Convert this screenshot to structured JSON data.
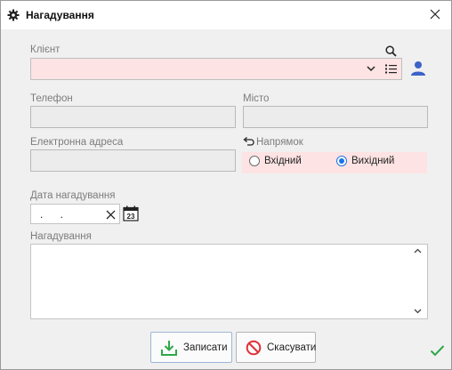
{
  "window": {
    "title": "Нагадування",
    "icon": "gear-icon",
    "close_icon": "close-icon"
  },
  "client": {
    "label": "Клієнт",
    "value": "",
    "search_icon": "search-icon",
    "dropdown_icon": "chevron-down-icon",
    "list_icon": "list-icon",
    "person_icon": "person-icon"
  },
  "phone": {
    "label": "Телефон",
    "value": ""
  },
  "city": {
    "label": "Місто",
    "value": ""
  },
  "email": {
    "label": "Електронна адреса",
    "value": ""
  },
  "direction": {
    "label": "Напрямок",
    "icon": "undo-arrow-icon",
    "options": [
      {
        "label": "Вхідний",
        "checked": false
      },
      {
        "label": "Вихідний",
        "checked": true
      }
    ]
  },
  "reminder_date": {
    "label": "Дата нагадування",
    "value": ". .",
    "calendar_day": "23"
  },
  "reminder_text": {
    "label": "Нагадування",
    "value": ""
  },
  "buttons": {
    "save_label": "Записати",
    "cancel_label": "Скасувати"
  },
  "colors": {
    "required_bg": "#fde3e3",
    "accent": "#1a73e8",
    "save_green": "#2ea84a",
    "cancel_red": "#e0303a",
    "person_blue": "#3b63c8"
  }
}
